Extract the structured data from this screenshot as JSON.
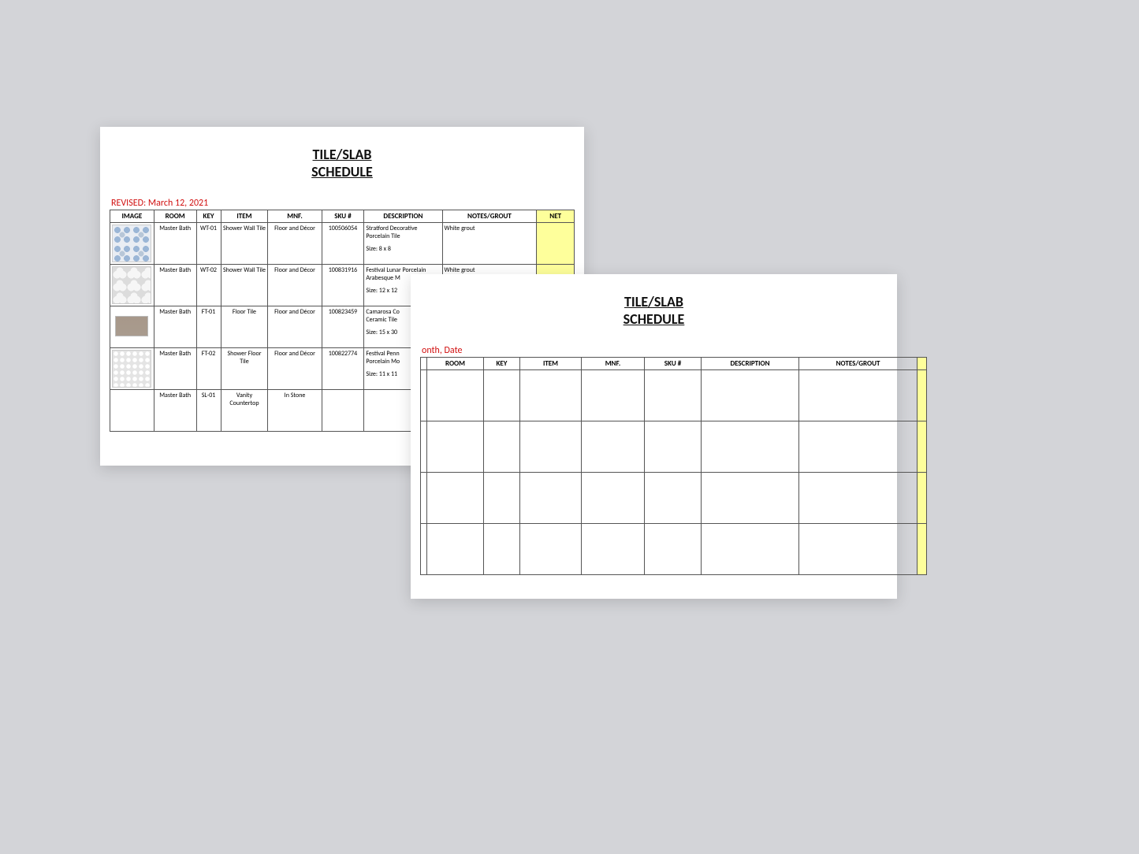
{
  "sheet1": {
    "title_line1": "TILE/SLAB",
    "title_line2": "SCHEDULE",
    "revised_label": "REVISED: March 12, 2021",
    "headers": {
      "image": "IMAGE",
      "room": "ROOM",
      "key": "KEY",
      "item": "ITEM",
      "mnf": "MNF.",
      "sku": "SKU #",
      "desc": "DESCRIPTION",
      "notes": "NOTES/GROUT",
      "net": "NET"
    },
    "rows": [
      {
        "image_name": "damask-tile-swatch",
        "room": "Master Bath",
        "key": "WT-01",
        "item": "Shower Wall Tile",
        "mnf": "Floor and Décor",
        "sku": "100506054",
        "desc_l1": "Stratford Decorative",
        "desc_l2": "Porcelain Tile",
        "desc_size": "Size: 8 x 8",
        "notes": "White grout",
        "net": ""
      },
      {
        "image_name": "arabesque-tile-swatch",
        "room": "Master Bath",
        "key": "WT-02",
        "item": "Shower Wall Tile",
        "mnf": "Floor and Décor",
        "sku": "100831916",
        "desc_l1": "Festival Lunar Porcelain",
        "desc_l2": "Arabesque M",
        "desc_size": "Size: 12 x 12",
        "notes": "White grout",
        "net": ""
      },
      {
        "image_name": "camarosa-tile-swatch",
        "room": "Master Bath",
        "key": "FT-01",
        "item": "Floor Tile",
        "mnf": "Floor and Décor",
        "sku": "100823459",
        "desc_l1": "Camarosa Co",
        "desc_l2": "Ceramic Tile",
        "desc_size": "Size: 15 x 30",
        "notes": "",
        "net": ""
      },
      {
        "image_name": "penny-tile-swatch",
        "room": "Master Bath",
        "key": "FT-02",
        "item": "Shower Floor Tile",
        "mnf": "Floor and Décor",
        "sku": "100822774",
        "desc_l1": "Festival Penn",
        "desc_l2": "Porcelain Mo",
        "desc_size": "Size: 11 x 11",
        "notes": "",
        "net": ""
      },
      {
        "image_name": "blank-swatch",
        "room": "Master Bath",
        "key": "SL-01",
        "item": "Vanity Countertop",
        "mnf": "In Stone",
        "sku": "",
        "desc_l1": "",
        "desc_l2": "",
        "desc_size": "",
        "notes": "",
        "net": ""
      }
    ]
  },
  "sheet2": {
    "title_line1": "TILE/SLAB",
    "title_line2": "SCHEDULE",
    "revised_label": "onth, Date",
    "headers": {
      "image": "",
      "room": "ROOM",
      "key": "KEY",
      "item": "ITEM",
      "mnf": "MNF.",
      "sku": "SKU #",
      "desc": "DESCRIPTION",
      "notes": "NOTES/GROUT",
      "net": ""
    },
    "blank_rows": 4
  }
}
